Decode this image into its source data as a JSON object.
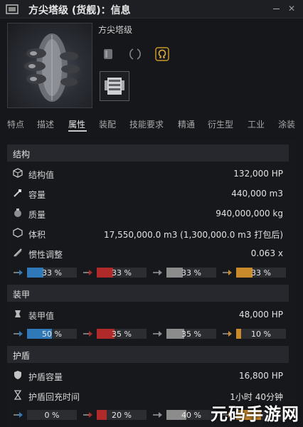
{
  "window": {
    "title": "方尖塔级 (货舰)：信息",
    "colors": {
      "background": "#16171a",
      "titlebar": "#1e1f23"
    }
  },
  "ship": {
    "name": "方尖塔级"
  },
  "tabs": [
    {
      "label": "特点"
    },
    {
      "label": "描述"
    },
    {
      "label": "属性",
      "active": true
    },
    {
      "label": "装配"
    },
    {
      "label": "技能要求"
    },
    {
      "label": "精通"
    },
    {
      "label": "衍生型"
    },
    {
      "label": "工业"
    },
    {
      "label": "涂装"
    }
  ],
  "sections": {
    "structure": {
      "header": "结构",
      "rows": [
        {
          "icon": "structure-icon",
          "label": "结构值",
          "value": "132,000 HP"
        },
        {
          "icon": "capacity-icon",
          "label": "容量",
          "value": "440,000 m3"
        },
        {
          "icon": "mass-icon",
          "label": "质量",
          "value": "940,000,000 kg"
        },
        {
          "icon": "volume-icon",
          "label": "体积",
          "value": "17,550,000.0 m3 (1,300,000.0 m3 打包后)"
        },
        {
          "icon": "inertia-icon",
          "label": "惯性调整",
          "value": "0.063 x"
        }
      ],
      "resists": [
        "33 %",
        "33 %",
        "33 %",
        "33 %"
      ],
      "resist_fractions": [
        0.33,
        0.33,
        0.33,
        0.33
      ]
    },
    "armor": {
      "header": "装甲",
      "rows": [
        {
          "icon": "armor-icon",
          "label": "装甲值",
          "value": "48,000 HP"
        }
      ],
      "resists": [
        "50 %",
        "35 %",
        "35 %",
        "10 %"
      ],
      "resist_fractions": [
        0.5,
        0.35,
        0.35,
        0.1
      ]
    },
    "shield": {
      "header": "护盾",
      "rows": [
        {
          "icon": "shield-icon",
          "label": "护盾容量",
          "value": "16,800 HP"
        },
        {
          "icon": "hourglass-icon",
          "label": "护盾回充时间",
          "value": "1小时 40分钟"
        }
      ],
      "resists": [
        "0 %",
        "20 %",
        "40 %",
        ""
      ],
      "resist_fractions": [
        0.0,
        0.2,
        0.4,
        0.5
      ]
    }
  },
  "resist_colors": {
    "em": "#2f79b8",
    "thermal": "#b02a2a",
    "kinetic": "#8c8c8c",
    "explosive": "#c98a2c"
  },
  "watermark": "元码手游网"
}
